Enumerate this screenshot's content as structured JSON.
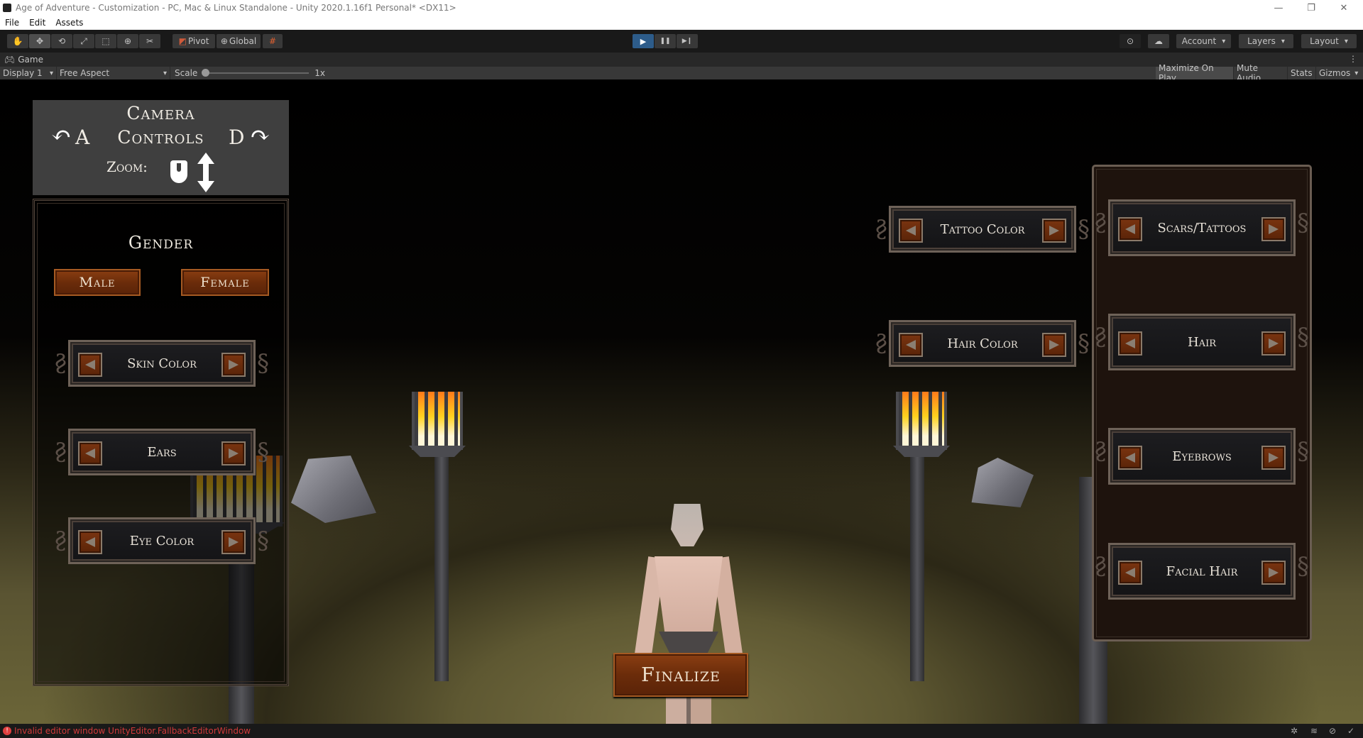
{
  "window": {
    "title": "Age of Adventure - Customization - PC, Mac & Linux Standalone - Unity 2020.1.16f1 Personal* <DX11>",
    "controls": [
      "minimize",
      "restore",
      "close"
    ]
  },
  "menu": [
    "File",
    "Edit",
    "Assets"
  ],
  "toolbar": {
    "tools": [
      {
        "name": "hand-tool",
        "glyph": "✋"
      },
      {
        "name": "move-tool",
        "glyph": "✥"
      },
      {
        "name": "rotate-tool",
        "glyph": "⟲"
      },
      {
        "name": "scale-tool",
        "glyph": "⤢"
      },
      {
        "name": "rect-tool",
        "glyph": "⬚"
      },
      {
        "name": "transform-tool",
        "glyph": "⊕"
      },
      {
        "name": "custom-tool",
        "glyph": "✂"
      }
    ],
    "pivot_label": "Pivot",
    "global_label": "Global",
    "snap_glyph": "#",
    "play_glyph": "▶",
    "pause_glyph": "❚❚",
    "step_glyph": "▶❙",
    "account_label": "Account",
    "layers_label": "Layers",
    "layout_label": "Layout",
    "collab_glyph": "☁",
    "services_glyph": "⊙"
  },
  "game_tab": {
    "label": "Game",
    "display": "Display 1",
    "aspect": "Free Aspect",
    "scale_label": "Scale",
    "scale_value": "1x",
    "toggles": [
      "Maximize On Play",
      "Mute Audio",
      "Stats",
      "Gizmos"
    ]
  },
  "game": {
    "camera": {
      "title_line1": "Camera",
      "title_line2": "Controls",
      "rotate_left_key": "A",
      "rotate_right_key": "D",
      "zoom_label": "Zoom:",
      "rotate_left_glyph": "↶",
      "rotate_right_glyph": "↷"
    },
    "gender": {
      "label": "Gender",
      "male": "Male",
      "female": "Female"
    },
    "left_selectors": [
      "Skin Color",
      "Ears",
      "Eye Color"
    ],
    "middle_selectors": [
      "Tattoo Color",
      "Hair Color"
    ],
    "right_selectors": [
      "Scars/Tattoos",
      "Hair",
      "Eyebrows",
      "Facial Hair"
    ],
    "finalize": "Finalize"
  },
  "status": {
    "message": "Invalid editor window UnityEditor.FallbackEditorWindow",
    "icons": [
      "debug-off-icon",
      "cache-icon",
      "network-off-icon",
      "check-icon"
    ]
  },
  "colors": {
    "play_active": "#2d5c8a",
    "error": "#d03a3a",
    "wood": "#6b2c0a",
    "panel_brown": "#1e130d"
  }
}
